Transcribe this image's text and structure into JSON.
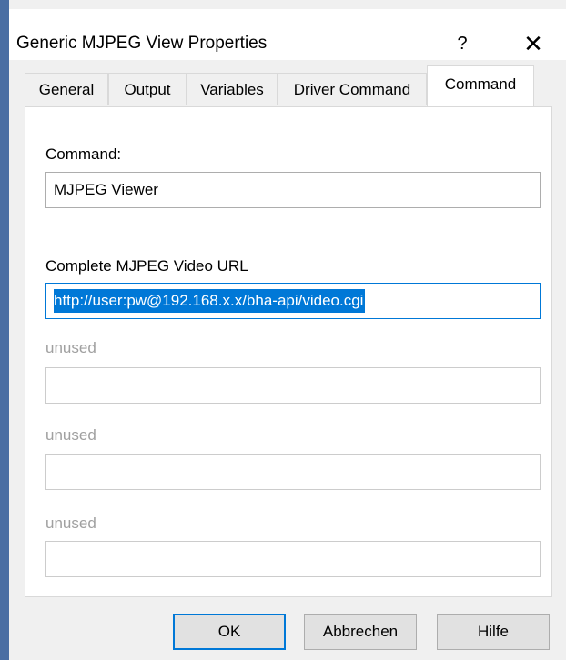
{
  "window": {
    "title": "Generic MJPEG View Properties",
    "help_label": "?",
    "close_label": "✕"
  },
  "tabs": [
    {
      "label": "General",
      "active": false
    },
    {
      "label": "Output",
      "active": false
    },
    {
      "label": "Variables",
      "active": false
    },
    {
      "label": "Driver Command",
      "active": false
    },
    {
      "label": "Command",
      "active": true
    }
  ],
  "form": {
    "command_label": "Command:",
    "command_value": "MJPEG Viewer",
    "url_label": "Complete MJPEG Video URL",
    "url_value": "http://user:pw@192.168.x.x/bha-api/video.cgi",
    "unused1_label": "unused",
    "unused1_value": "",
    "unused2_label": "unused",
    "unused2_value": "",
    "unused3_label": "unused",
    "unused3_value": ""
  },
  "buttons": {
    "ok": "OK",
    "cancel": "Abbrechen",
    "help": "Hilfe"
  },
  "colors": {
    "accent": "#0078d7",
    "dialog_bg": "#f0f0f0",
    "disabled_text": "#a0a0a0"
  }
}
